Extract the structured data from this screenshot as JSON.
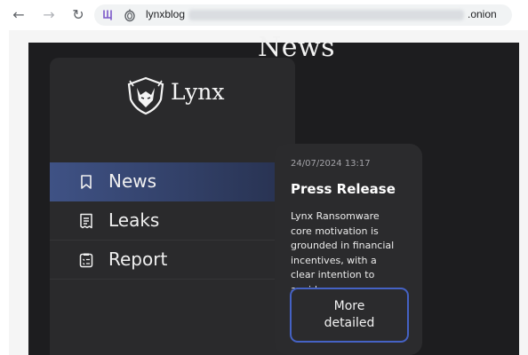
{
  "browser": {
    "address_host": "lynxblog",
    "address_suffix": ".onion"
  },
  "site": {
    "brand": "Lynx",
    "page_heading": "News",
    "accent_color": "#4562c4"
  },
  "sidebar": {
    "items": [
      {
        "label": "News",
        "icon": "bookmark-icon",
        "active": true
      },
      {
        "label": "Leaks",
        "icon": "receipt-icon",
        "active": false
      },
      {
        "label": "Report",
        "icon": "clipboard-icon",
        "active": false
      }
    ]
  },
  "post": {
    "date": "24/07/2024 13:17",
    "title": "Press Release",
    "text_lines": [
      "Lynx Ransomware",
      "core motivation is",
      "grounded in financial",
      "incentives, with a",
      "clear intention to",
      "avoid..."
    ],
    "button_lines": [
      "More",
      "detailed"
    ]
  }
}
